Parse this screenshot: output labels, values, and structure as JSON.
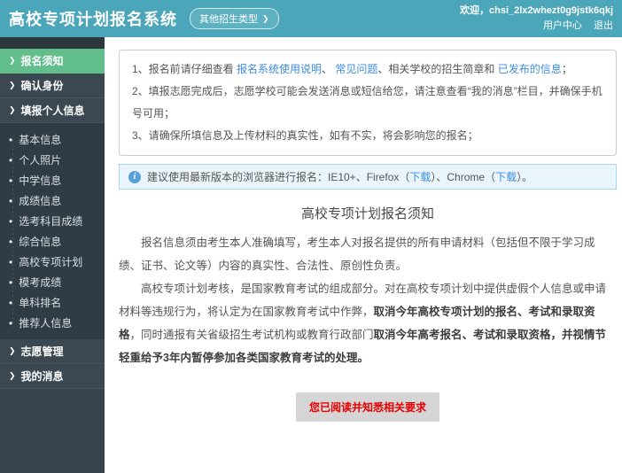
{
  "header": {
    "app_title": "高校专项计划报名系统",
    "other_admission_types": "其他招生类型",
    "chevron": "❯",
    "welcome_text": "欢迎，chsi_2lx2whezt0g9jstk6qkj",
    "user_center": "用户中心",
    "logout": "退出"
  },
  "sidebar": {
    "arrow": "❯",
    "bullet": "•",
    "top_groups": [
      {
        "label": "报名须知"
      },
      {
        "label": "确认身份"
      },
      {
        "label": "填报个人信息"
      }
    ],
    "sub_items": [
      {
        "label": "基本信息"
      },
      {
        "label": "个人照片"
      },
      {
        "label": "中学信息"
      },
      {
        "label": "成绩信息"
      },
      {
        "label": "选考科目成绩"
      },
      {
        "label": "综合信息"
      },
      {
        "label": "高校专项计划"
      },
      {
        "label": "模考成绩"
      },
      {
        "label": "单科排名"
      },
      {
        "label": "推荐人信息"
      }
    ],
    "bottom_groups": [
      {
        "label": "志愿管理"
      },
      {
        "label": "我的消息"
      }
    ]
  },
  "notice_box": {
    "item1": {
      "text1": "1、报名前请仔细查看 ",
      "link1": "报名系统使用说明",
      "text2": "、 ",
      "link2": "常见问题",
      "text3": "、相关学校的招生简章和 ",
      "link3": "已发布的信息",
      "text4": "；"
    },
    "item2": "2、填报志愿完成后，志愿学校可能会发送消息或短信给您，请注意查看“我的消息”栏目，并确保手机号可用；",
    "item3": "3、请确保所填信息及上传材料的真实性，如有不实，将会影响您的报名；"
  },
  "browser_bar": {
    "icon_glyph": "i",
    "text1": "建议使用最新版本的浏览器进行报名：IE10+、Firefox（",
    "link1": "下载",
    "text2": "）、Chrome（",
    "link2": "下载",
    "text3": "）。"
  },
  "main": {
    "title": "高校专项计划报名须知",
    "para1": "报名信息须由考生本人准确填写，考生本人对报名提供的所有申请材料（包括但不限于学习成绩、证书、论文等）内容的真实性、合法性、原创性负责。",
    "para2": {
      "normal1": "高校专项计划考核，是国家教育考试的组成部分。对在高校专项计划中提供虚假个人信息或申请材料等违规行为，将认定为在国家教育考试中作弊，",
      "bold1": "取消今年高校专项计划的报名、考试和录取资格",
      "normal2": "，同时通报有关省级招生考试机构或教育行政部门",
      "bold2": "取消今年高考报名、考试和录取资格，并视情节轻重给予3年内暂停参加各类国家教育考试的处理。"
    },
    "ack_button": "您已阅读并知悉相关要求"
  },
  "colors": {
    "header_teal": "#4aa6b8",
    "sidebar_dark": "#37444d",
    "sidebar_sub_dark": "#2f3c44",
    "active_green": "#62bf8c",
    "link_blue": "#3e8ddd",
    "button_bg_gray": "#d5d5d5",
    "button_text_red": "#e60000",
    "info_bar_bg": "#eaf4fb",
    "info_bar_border": "#a8d7f3"
  }
}
